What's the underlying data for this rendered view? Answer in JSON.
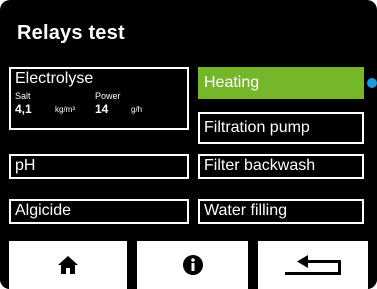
{
  "title": "Relays test",
  "colors": {
    "active": "#76b72a",
    "indicator": "#1b9ce2"
  },
  "electrolyse": {
    "label": "Electrolyse",
    "salt_label": "Salt",
    "power_label": "Power",
    "salt_value": "4,1",
    "salt_unit": "kg/m³",
    "power_value": "14",
    "power_unit": "g/h"
  },
  "buttons": {
    "ph": "pH",
    "algicide": "Algicide",
    "heating": "Heating",
    "filtration": "Filtration pump",
    "backwash": "Filter backwash",
    "filling": "Water filling"
  },
  "nav": {
    "home_icon": "home-icon",
    "info_icon": "info-icon",
    "back_icon": "return-arrow-icon"
  }
}
